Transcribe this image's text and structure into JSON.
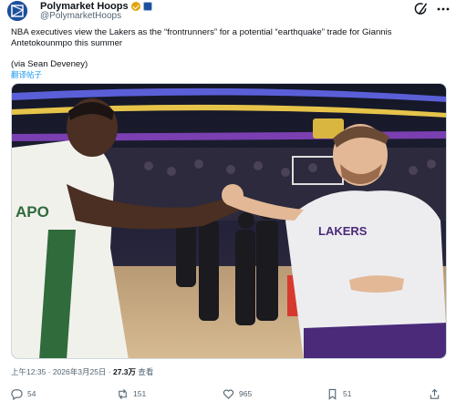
{
  "author": {
    "display_name": "Polymarket Hoops",
    "handle": "@PolymarketHoops"
  },
  "post": {
    "text": "NBA executives view the Lakers as the “frontrunners” for a potential “earthquake” trade for Giannis Antetokounmpo this summer",
    "credit": "(via Sean Deveney)",
    "translate_label": "翻译帖子"
  },
  "meta": {
    "timestamp": "上午12:35 · 2026年3月25日 · ",
    "views_count": "27.3万",
    "views_label": " 查看"
  },
  "photo": {
    "left_jersey_text": "APO",
    "right_jersey_text": "LAKERS"
  },
  "actions": {
    "replies": "54",
    "reposts": "151",
    "likes": "965",
    "bookmarks": "51"
  },
  "colors": {
    "link": "#1d9bf0",
    "muted": "#536471",
    "verified": "#e2a40f"
  }
}
